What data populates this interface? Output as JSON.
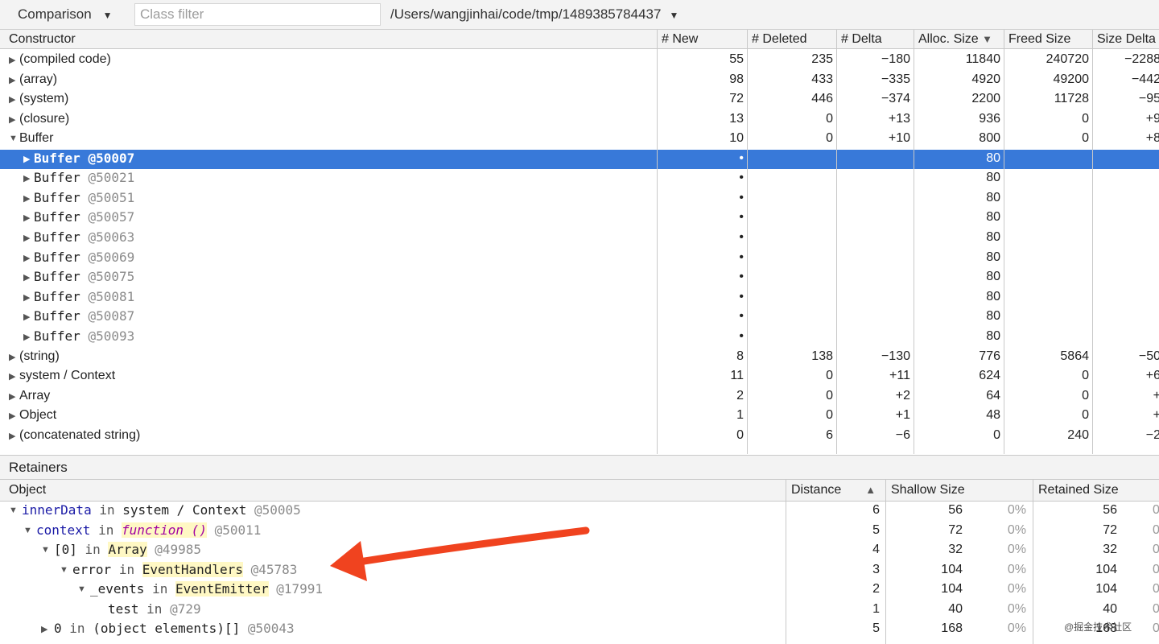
{
  "toolbar": {
    "view_mode": "Comparison",
    "class_filter_placeholder": "Class filter",
    "class_filter_value": "",
    "snapshot_path": "/Users/wangjinhai/code/tmp/1489385784437"
  },
  "top_table": {
    "columns": [
      "Constructor",
      "# New",
      "# Deleted",
      "# Delta",
      "Alloc. Size",
      "Freed Size",
      "Size Delta"
    ],
    "sort_indicator": "▼",
    "rows": [
      {
        "name": "(compiled code)",
        "expanded": false,
        "new": "55",
        "deleted": "235",
        "delta": "−180",
        "alloc": "11840",
        "freed": "240720",
        "size_delta": "−2288"
      },
      {
        "name": "(array)",
        "expanded": false,
        "new": "98",
        "deleted": "433",
        "delta": "−335",
        "alloc": "4920",
        "freed": "49200",
        "size_delta": "−442"
      },
      {
        "name": "(system)",
        "expanded": false,
        "new": "72",
        "deleted": "446",
        "delta": "−374",
        "alloc": "2200",
        "freed": "11728",
        "size_delta": "−95"
      },
      {
        "name": "(closure)",
        "expanded": false,
        "new": "13",
        "deleted": "0",
        "delta": "+13",
        "alloc": "936",
        "freed": "0",
        "size_delta": "+9"
      },
      {
        "name": "Buffer",
        "expanded": true,
        "new": "10",
        "deleted": "0",
        "delta": "+10",
        "alloc": "800",
        "freed": "0",
        "size_delta": "+8"
      }
    ],
    "buffer_children": [
      {
        "name": "Buffer",
        "id": "@50007",
        "new": "•",
        "alloc": "80",
        "selected": true
      },
      {
        "name": "Buffer",
        "id": "@50021",
        "new": "•",
        "alloc": "80",
        "selected": false
      },
      {
        "name": "Buffer",
        "id": "@50051",
        "new": "•",
        "alloc": "80",
        "selected": false
      },
      {
        "name": "Buffer",
        "id": "@50057",
        "new": "•",
        "alloc": "80",
        "selected": false
      },
      {
        "name": "Buffer",
        "id": "@50063",
        "new": "•",
        "alloc": "80",
        "selected": false
      },
      {
        "name": "Buffer",
        "id": "@50069",
        "new": "•",
        "alloc": "80",
        "selected": false
      },
      {
        "name": "Buffer",
        "id": "@50075",
        "new": "•",
        "alloc": "80",
        "selected": false
      },
      {
        "name": "Buffer",
        "id": "@50081",
        "new": "•",
        "alloc": "80",
        "selected": false
      },
      {
        "name": "Buffer",
        "id": "@50087",
        "new": "•",
        "alloc": "80",
        "selected": false
      },
      {
        "name": "Buffer",
        "id": "@50093",
        "new": "•",
        "alloc": "80",
        "selected": false
      }
    ],
    "rows_after": [
      {
        "name": "(string)",
        "new": "8",
        "deleted": "138",
        "delta": "−130",
        "alloc": "776",
        "freed": "5864",
        "size_delta": "−50"
      },
      {
        "name": "system / Context",
        "new": "11",
        "deleted": "0",
        "delta": "+11",
        "alloc": "624",
        "freed": "0",
        "size_delta": "+6"
      },
      {
        "name": "Array",
        "new": "2",
        "deleted": "0",
        "delta": "+2",
        "alloc": "64",
        "freed": "0",
        "size_delta": "+"
      },
      {
        "name": "Object",
        "new": "1",
        "deleted": "0",
        "delta": "+1",
        "alloc": "48",
        "freed": "0",
        "size_delta": "+"
      },
      {
        "name": "(concatenated string)",
        "new": "0",
        "deleted": "6",
        "delta": "−6",
        "alloc": "0",
        "freed": "240",
        "size_delta": "−2"
      }
    ]
  },
  "retainers": {
    "title": "Retainers",
    "columns": [
      "Object",
      "Distance",
      "Shallow Size",
      "Retained Size"
    ],
    "sort_indicator": "▲",
    "rows": [
      {
        "prefix": "",
        "name": "innerData",
        "in": "in",
        "owner": "system / Context",
        "id": "@50005",
        "distance": "6",
        "shallow": "56",
        "shallow_pct": "0%",
        "retained": "56",
        "retained_pct": "0"
      },
      {
        "prefix": "",
        "name": "context",
        "in": "in",
        "owner": "function ()",
        "id": "@50011",
        "distance": "5",
        "shallow": "72",
        "shallow_pct": "0%",
        "retained": "72",
        "retained_pct": "0"
      },
      {
        "prefix": "",
        "name": "[0]",
        "in": "in",
        "owner": "Array",
        "id": "@49985",
        "distance": "4",
        "shallow": "32",
        "shallow_pct": "0%",
        "retained": "32",
        "retained_pct": "0"
      },
      {
        "prefix": "",
        "name": "error",
        "in": "in",
        "owner": "EventHandlers",
        "id": "@45783",
        "distance": "3",
        "shallow": "104",
        "shallow_pct": "0%",
        "retained": "104",
        "retained_pct": "0"
      },
      {
        "prefix": "",
        "name": "_events",
        "in": "in",
        "owner": "EventEmitter",
        "id": "@17991",
        "distance": "2",
        "shallow": "104",
        "shallow_pct": "0%",
        "retained": "104",
        "retained_pct": "0"
      },
      {
        "prefix": "",
        "name": "test",
        "in": "in",
        "owner": "",
        "id": "@729",
        "distance": "1",
        "shallow": "40",
        "shallow_pct": "0%",
        "retained": "40",
        "retained_pct": "0"
      },
      {
        "prefix": "",
        "name": "0",
        "in": "in",
        "owner": "(object elements)[]",
        "id": "@50043",
        "distance": "5",
        "shallow": "168",
        "shallow_pct": "0%",
        "retained": "168",
        "retained_pct": "0"
      }
    ]
  },
  "annotation": {
    "arrow_color": "#f0431f"
  },
  "watermark": "@掘金技术社区",
  "colors": {
    "selection": "#3879d9",
    "highlight": "#fff8c4",
    "function_text": "#a100a1",
    "property_text": "#1a1aa6"
  }
}
